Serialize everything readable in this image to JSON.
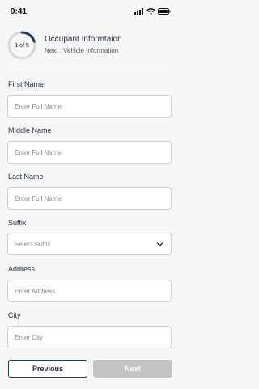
{
  "status_bar": {
    "time": "9:41",
    "icons": [
      "signal-icon",
      "wifi-icon",
      "battery-icon"
    ]
  },
  "header": {
    "progress_label": "1 of 5",
    "progress_fraction": 0.2,
    "title": "Occupant Informtaion",
    "next": "Next : Vehicle Information"
  },
  "form": {
    "first_name": {
      "label": "First Name",
      "placeholder": "Enter Full Name"
    },
    "middle_name": {
      "label": "MIddle Name",
      "placeholder": "Enter Full Name"
    },
    "last_name": {
      "label": "Last Name",
      "placeholder": "Enter Full Name"
    },
    "suffix": {
      "label": "Suffix",
      "selected": "Select Suffix"
    },
    "address": {
      "label": "Address",
      "placeholder": "Enter Address"
    },
    "city": {
      "label": "City",
      "placeholder": "Enter City"
    }
  },
  "footer": {
    "previous_label": "Previous",
    "next_label": "Next"
  },
  "colors": {
    "primary": "#1f3a5f",
    "progress_track": "#d9d9d9",
    "disabled_button": "#c4c4c4"
  }
}
